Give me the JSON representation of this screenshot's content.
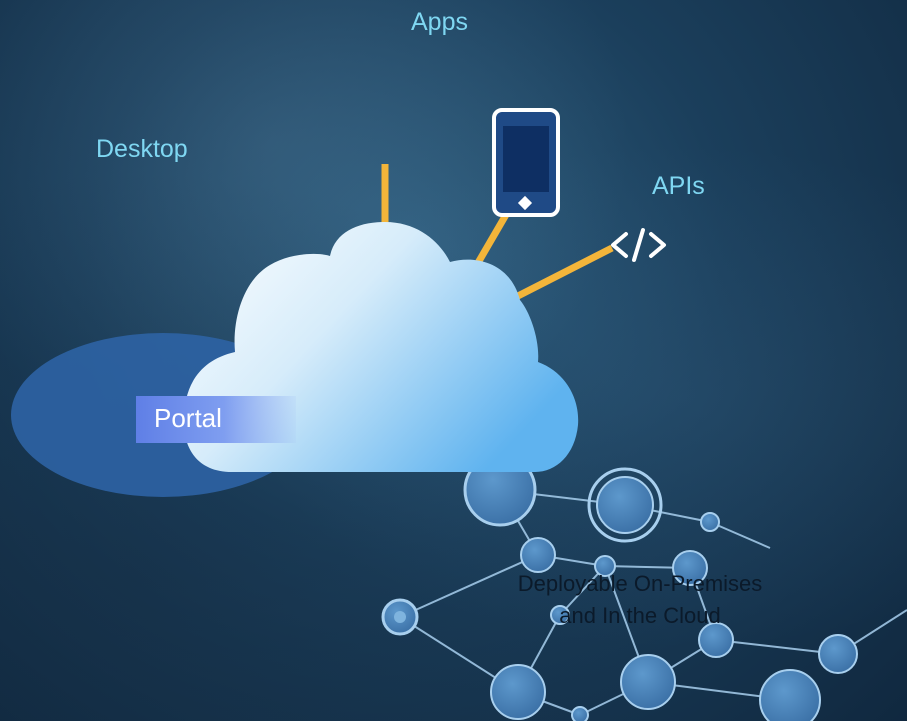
{
  "labels": {
    "apps": "Apps",
    "desktop": "Desktop",
    "apis": "APIs",
    "portal": "Portal",
    "deployable_line1": "Deployable On-Premises",
    "deployable_line2": "and In the Cloud"
  },
  "icons": {
    "mobile": "mobile-phone-icon",
    "api": "code-brackets-icon"
  },
  "colors": {
    "label_text": "#7fd7f2",
    "connector": "#f3b53a",
    "portal_fill": "#5f7fe6",
    "ellipse_fill": "#2d63a4",
    "node_fill": "#4a86bd",
    "node_stroke": "#a8cfee"
  }
}
